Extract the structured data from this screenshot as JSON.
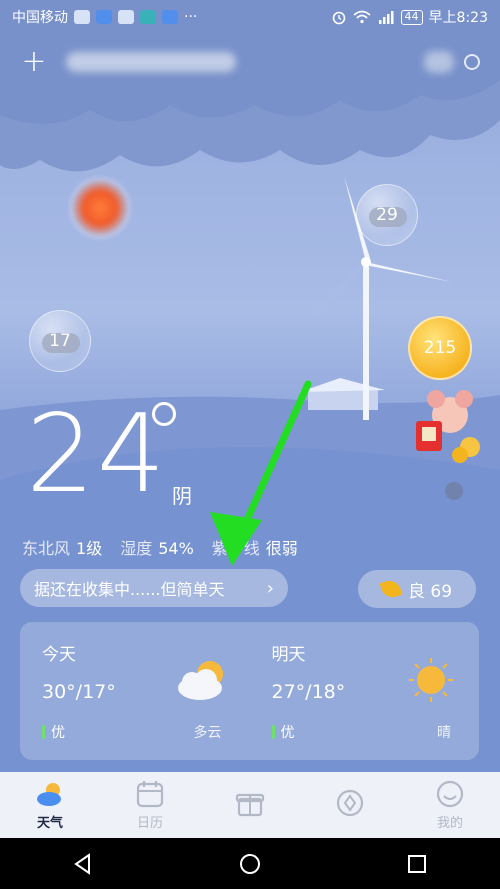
{
  "status_bar": {
    "carrier": "中国移动",
    "dots": "···",
    "battery": "44",
    "time": "早上8:23"
  },
  "header": {
    "add_label": "+"
  },
  "bubbles": {
    "left_temp": "17",
    "right_temp": "29",
    "coin_value": "215"
  },
  "current": {
    "temperature": "24",
    "condition": "阴",
    "wind_label": "东北风",
    "wind_value": "1级",
    "humidity_label": "湿度",
    "humidity_value": "54%",
    "uv_label": "紫外线",
    "uv_value": "很弱"
  },
  "info_pill": {
    "text": "据还在收集中......但简单天",
    "chevron": "›"
  },
  "aqi": {
    "label": "良 69",
    "color": "#f3b51e"
  },
  "forecast": [
    {
      "day": "今天",
      "temp": "30°/17°",
      "aqi": "优",
      "condition": "多云",
      "icon": "partly-cloudy-icon"
    },
    {
      "day": "明天",
      "temp": "27°/18°",
      "aqi": "优",
      "condition": "晴",
      "icon": "sunny-icon"
    }
  ],
  "nav": [
    {
      "label": "天气",
      "icon": "weather-icon",
      "active": true
    },
    {
      "label": "日历",
      "icon": "calendar-icon",
      "active": false
    },
    {
      "label": "",
      "icon": "gift-icon",
      "active": false
    },
    {
      "label": "",
      "icon": "compass-icon",
      "active": false
    },
    {
      "label": "我的",
      "icon": "profile-icon",
      "active": false
    }
  ],
  "colors": {
    "arrow": "#22dd22",
    "aqi_good": "#6fe06c"
  }
}
